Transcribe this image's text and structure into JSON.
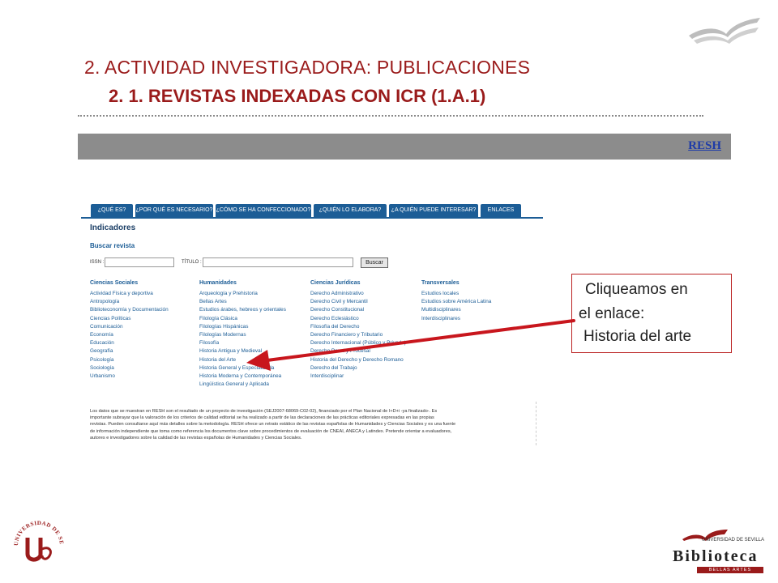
{
  "header": {
    "title": "2. ACTIVIDAD INVESTIGADORA: PUBLICACIONES",
    "subtitle": "2. 1. REVISTAS INDEXADAS CON ICR (1.A.1)"
  },
  "bar": {
    "link": "RESH"
  },
  "screenshot": {
    "nav": [
      "¿QUÉ ES?",
      "¿POR QUÉ ES NECESARIO?",
      "¿CÓMO SE HA CONFECCIONADO?",
      "¿QUIÉN LO ELABORA?",
      "¿A QUIÉN PUEDE INTERESAR?",
      "ENLACES"
    ],
    "heading": "Indicadores",
    "search_title": "Buscar revista",
    "issn_label": "ISSN :",
    "titulo_label": "TÍTULO :",
    "search_button": "Buscar",
    "columns": [
      {
        "head": "Ciencias Sociales",
        "items": [
          "Actividad Física y deportiva",
          "Antropología",
          "Biblioteconomía y Documentación",
          "Ciencias Políticas",
          "Comunicación",
          "Economía",
          "Educación",
          "Geografía",
          "Psicología",
          "Sociología",
          "Urbanismo"
        ]
      },
      {
        "head": "Humanidades",
        "items": [
          "Arqueología y Prehistoria",
          "Bellas Artes",
          "Estudios árabes, hebreos y orientales",
          "Filología Clásica",
          "Filologías Hispánicas",
          "Filologías Modernas",
          "Filosofía",
          "Historia Antigua y Medieval",
          "Historia del Arte",
          "Historia General y Especializada",
          "Historia Moderna y Contemporánea",
          "Lingüística General y Aplicada"
        ]
      },
      {
        "head": "Ciencias Jurídicas",
        "items": [
          "Derecho Administrativo",
          "Derecho Civil y Mercantil",
          "Derecho Constitucional",
          "Derecho Eclesiástico",
          "Filosofía del Derecho",
          "Derecho Financiero y Tributario",
          "Derecho Internacional (Público y Privado)",
          "Derecho Penal y Procesal",
          "Historia del Derecho y Derecho Romano",
          "Derecho del Trabajo",
          "Interdisciplinar"
        ]
      },
      {
        "head": "Transversales",
        "items": [
          "Estudios locales",
          "Estudios sobre América Latina",
          "Multidisciplinares",
          "Interdisciplinares"
        ]
      }
    ],
    "footer_lines": [
      "Los datos que se muestran en RESH son el resultado de un proyecto de investigación (SEJ2007-68069-C02-02), financiado por el Plan Nacional de I+D+i -ya finalizado-. Es",
      "importante subrayar que la valoración de los criterios de calidad editorial se ha realizado a partir de las declaraciones de las prácticas editoriales expresadas en las propias",
      "revistas. Pueden consultarse aquí más detalles sobre la metodología. RESH ofrece un retrato estático de las revistas españolas de Humanidades y Ciencias Sociales y es una fuente",
      "de información independiente que toma como referencia los documentos clave sobre procedimientos de evaluación de CNEAI, ANECA y Latindex. Pretende orientar a evaluadores,",
      "autores e investigadores sobre la calidad de las revistas españolas de Humanidades y Ciencias Sociales."
    ]
  },
  "callout": {
    "line1": "Cliqueamos en",
    "line2": "el enlace:",
    "line3": "Historia del arte"
  },
  "colors": {
    "accent": "#9a1b1b",
    "nav": "#1c5d96",
    "bar": "#8c8c8c",
    "link": "#1e3ba8"
  },
  "logos": {
    "seal_text": "UNIVERSIDAD DE SEVILLA",
    "library_small": "UNIVERSIDAD DE SEVILLA",
    "library_name": "Biblioteca",
    "library_sub": "BELLAS ARTES"
  }
}
